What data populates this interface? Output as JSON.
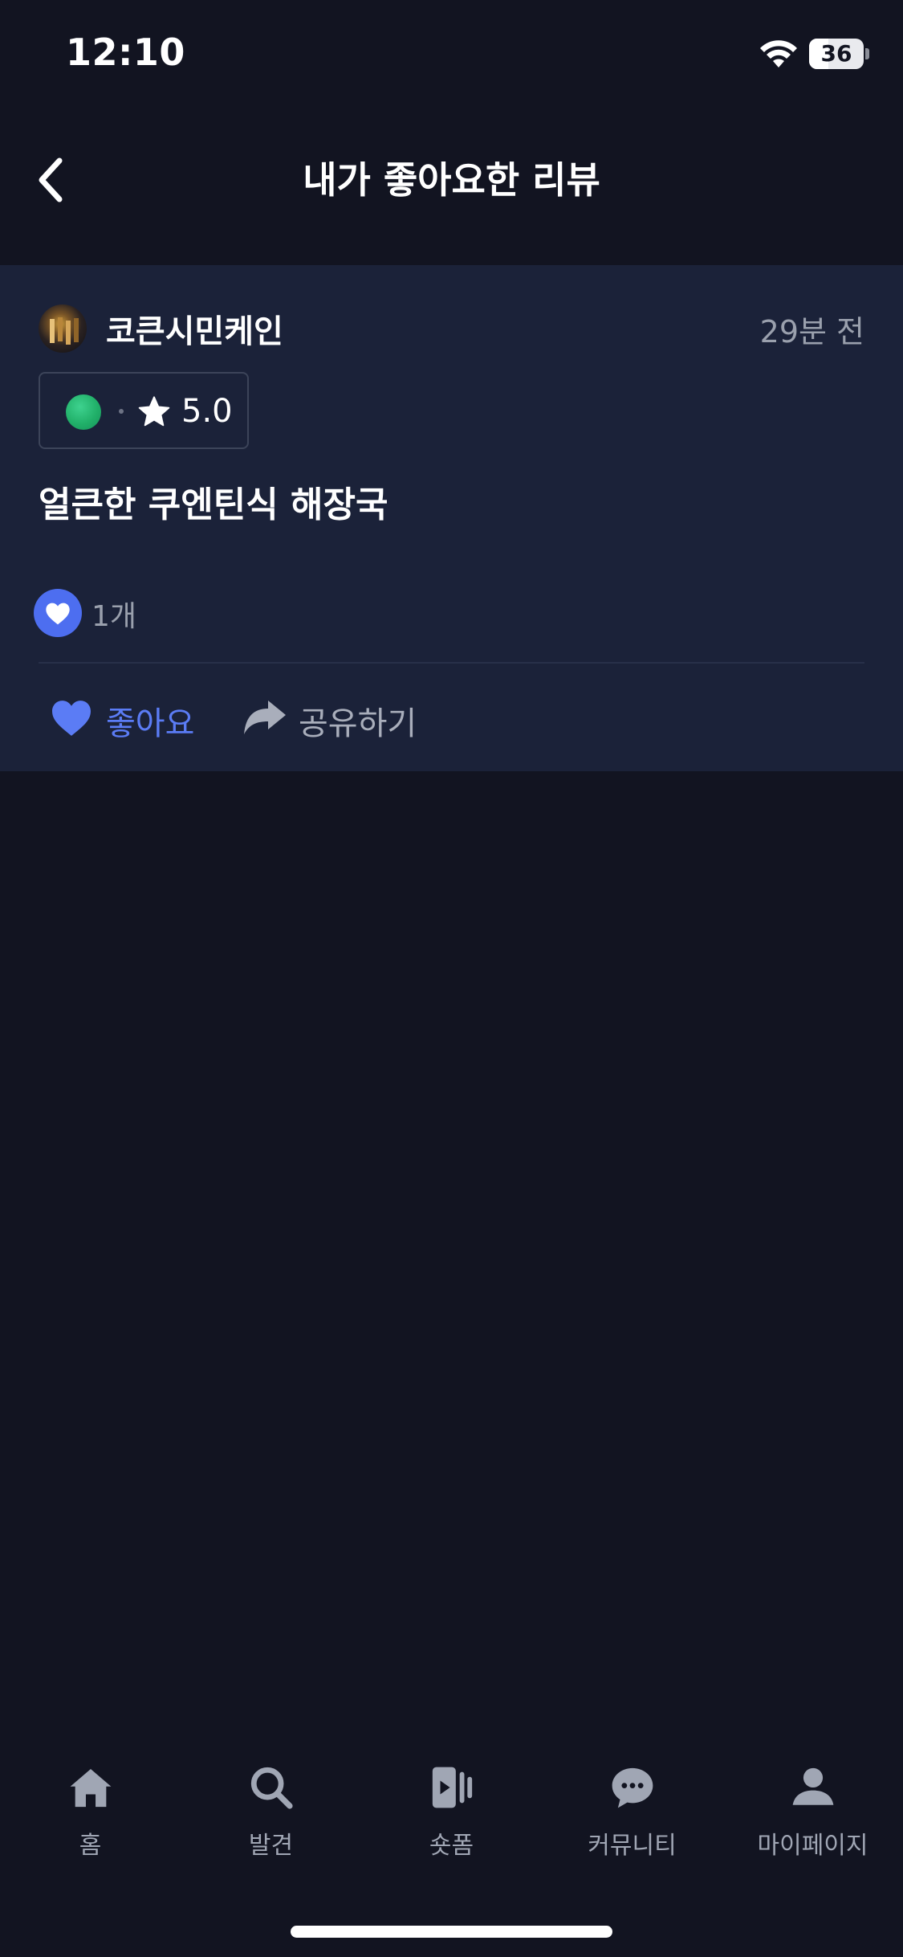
{
  "status_bar": {
    "time": "12:10",
    "battery": "36",
    "battery_level": 0.36
  },
  "header": {
    "title": "내가 좋아요한 리뷰",
    "back_icon": "chevron-left-icon"
  },
  "review": {
    "author": "코큰시민케인",
    "time_ago": "29분 전",
    "rating": "5.0",
    "text": "얼큰한 쿠엔틴식 해장국",
    "like_count": "1개",
    "actions": {
      "like_label": "좋아요",
      "share_label": "공유하기"
    }
  },
  "tab_bar": {
    "items": [
      {
        "label": "홈",
        "icon": "home-icon"
      },
      {
        "label": "발견",
        "icon": "search-icon"
      },
      {
        "label": "숏폼",
        "icon": "short-video-icon"
      },
      {
        "label": "커뮤니티",
        "icon": "chat-bubble-icon"
      },
      {
        "label": "마이페이지",
        "icon": "person-icon"
      }
    ]
  },
  "colors": {
    "background": "#121421",
    "card": "#1b2239",
    "accent": "#5b7cf5",
    "muted_text": "#9aa0ad",
    "rating_dot": "#21b069"
  }
}
